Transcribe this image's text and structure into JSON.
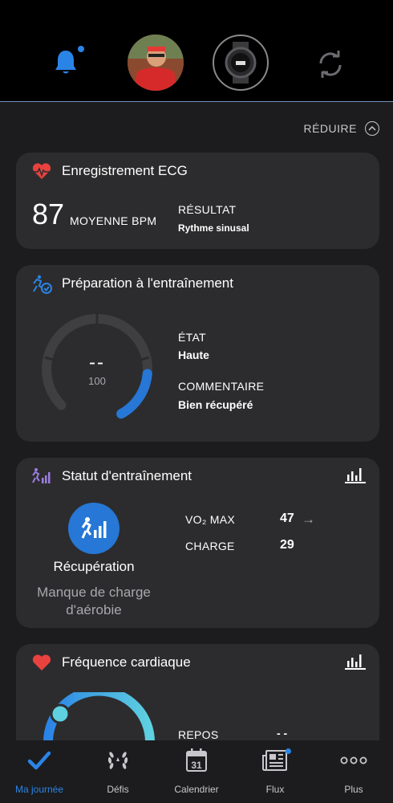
{
  "header": {
    "reduce_label": "RÉDUIRE"
  },
  "ecg_card": {
    "title": "Enregistrement ECG",
    "value": "87",
    "unit": "MOYENNE BPM",
    "result_label": "RÉSULTAT",
    "result_value": "Rythme sinusal"
  },
  "prep_card": {
    "title": "Préparation à l'entraînement",
    "gauge_value": "--",
    "gauge_max": "100",
    "state_label": "ÉTAT",
    "state_value": "Haute",
    "comment_label": "COMMENTAIRE",
    "comment_value": "Bien récupéré"
  },
  "status_card": {
    "title": "Statut d'entraînement",
    "status": "Récupération",
    "note": "Manque de charge d'aérobie",
    "vo2_label": "VO₂ MAX",
    "vo2_value": "47",
    "load_label": "CHARGE",
    "load_value": "29"
  },
  "hr_card": {
    "title": "Fréquence cardiaque",
    "rest_label": "REPOS",
    "rest_value": "- -"
  },
  "tabs": [
    {
      "label": "Ma journée",
      "icon": "check-icon"
    },
    {
      "label": "Défis",
      "icon": "laurel-icon"
    },
    {
      "label": "Calendrier",
      "icon": "calendar-icon",
      "day": "31"
    },
    {
      "label": "Flux",
      "icon": "newspaper-icon"
    },
    {
      "label": "Plus",
      "icon": "more-icon"
    }
  ],
  "colors": {
    "accent": "#2a84e6",
    "heart": "#e8423f",
    "card": "#2c2c2e",
    "background": "#1c1c1e"
  }
}
